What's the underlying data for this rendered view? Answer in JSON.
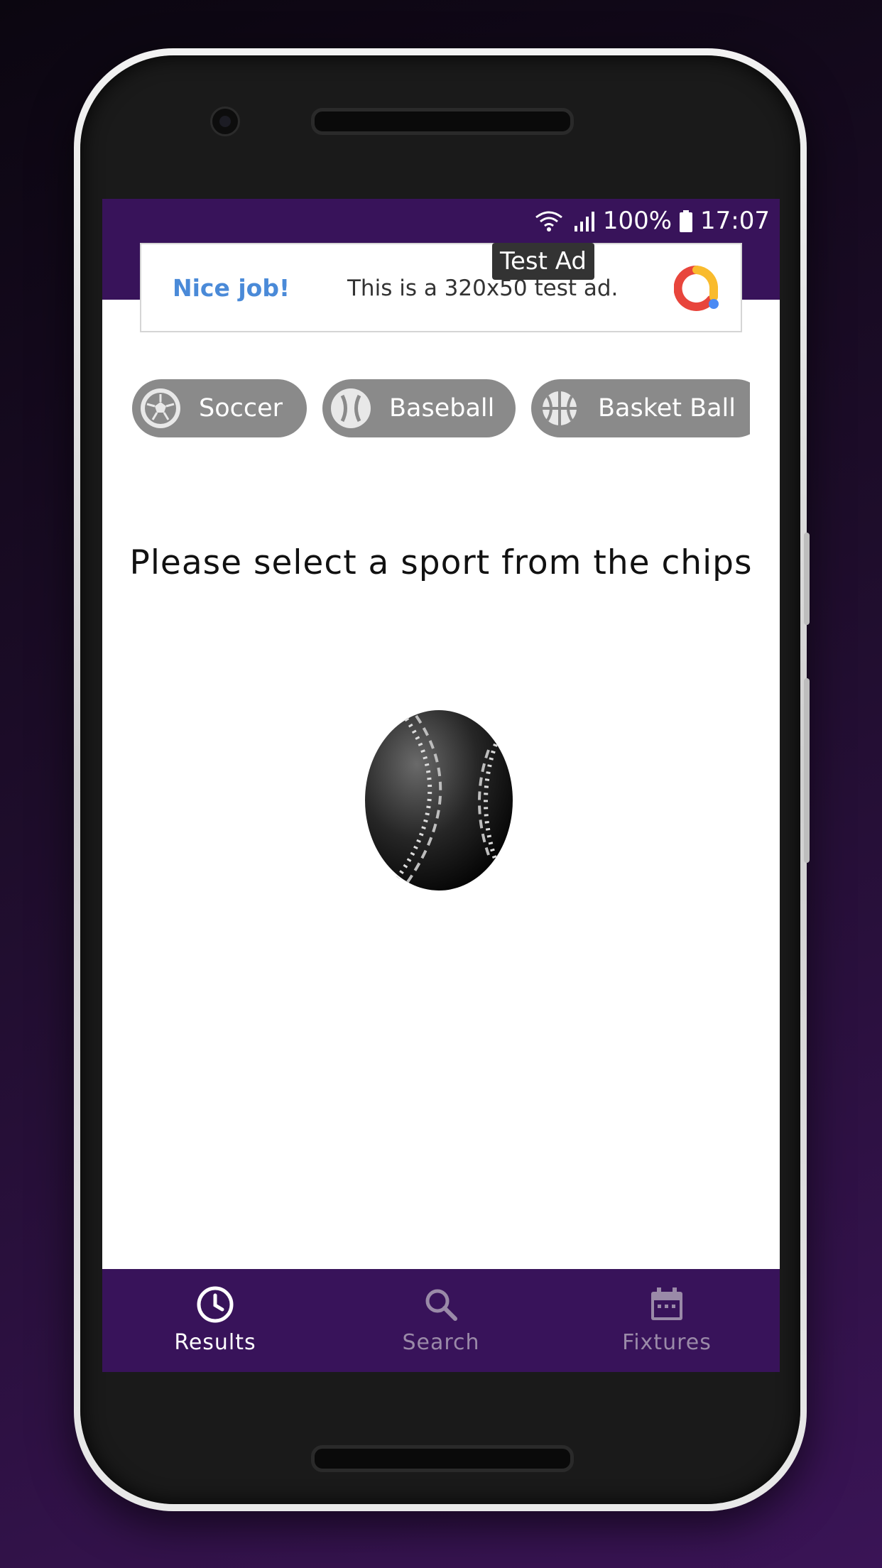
{
  "status_bar": {
    "battery": "100%",
    "time": "17:07"
  },
  "ad": {
    "badge": "Test Ad",
    "headline": "Nice job!",
    "body": "This is a 320x50 test ad.",
    "logo_icon": "google-ads-icon"
  },
  "chips": [
    {
      "label": "Soccer",
      "icon": "soccer-ball-icon"
    },
    {
      "label": "Baseball",
      "icon": "baseball-icon"
    },
    {
      "label": "Basket Ball",
      "icon": "basketball-icon"
    }
  ],
  "main": {
    "prompt": "Please select a sport from the chips",
    "illustration": "baseball-icon"
  },
  "bottom_nav": [
    {
      "label": "Results",
      "icon": "clock-icon",
      "active": true
    },
    {
      "label": "Search",
      "icon": "search-icon",
      "active": false
    },
    {
      "label": "Fixtures",
      "icon": "calendar-icon",
      "active": false
    }
  ],
  "colors": {
    "primary": "#38135a",
    "chip": "#8a8a8a",
    "ad_headline": "#4a8ad8"
  }
}
